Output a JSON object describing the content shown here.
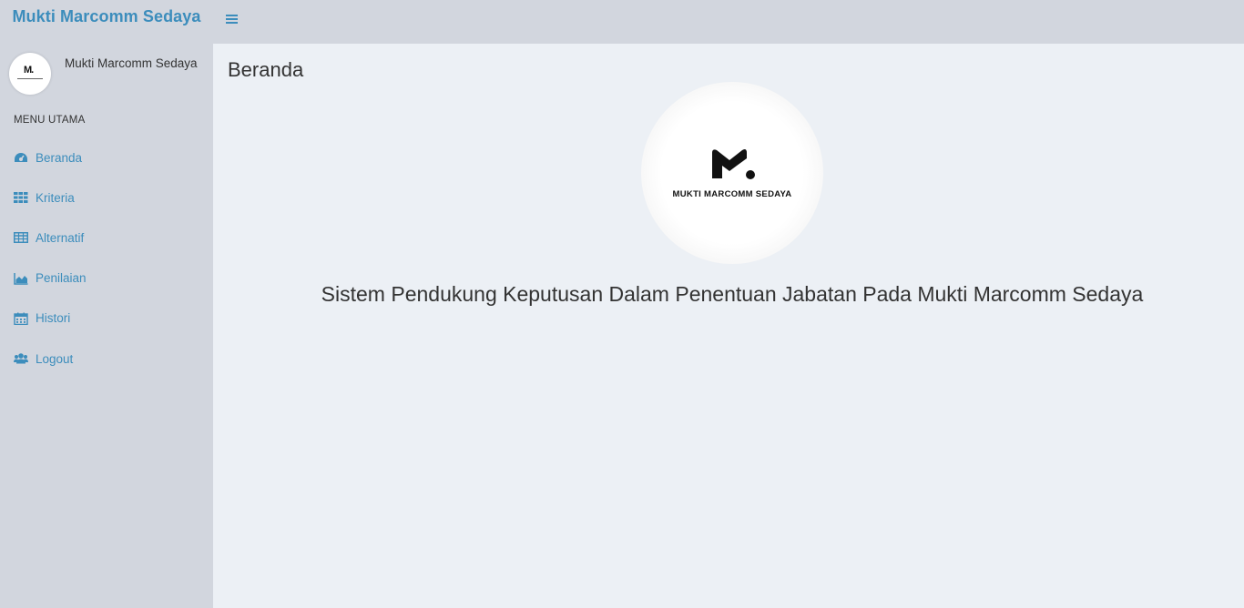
{
  "brand": {
    "title": "Mukti Marcomm Sedaya"
  },
  "user": {
    "name": "Mukti Marcomm Sedaya"
  },
  "sidebar": {
    "header": "MENU UTAMA",
    "items": [
      {
        "label": "Beranda",
        "icon": "dashboard-icon"
      },
      {
        "label": "Kriteria",
        "icon": "grid-icon"
      },
      {
        "label": "Alternatif",
        "icon": "table-icon"
      },
      {
        "label": "Penilaian",
        "icon": "area-chart-icon"
      },
      {
        "label": "Histori",
        "icon": "calendar-icon"
      },
      {
        "label": "Logout",
        "icon": "users-icon"
      }
    ]
  },
  "main": {
    "title": "Beranda",
    "logo_text": "MUKTI MARCOMM SEDAYA",
    "tagline": "Sistem Pendukung Keputusan Dalam Penentuan Jabatan Pada Mukti Marcomm Sedaya"
  },
  "colors": {
    "accent": "#3c8dbc",
    "sidebar_bg": "#d2d6de",
    "content_bg": "#ecf0f5"
  }
}
